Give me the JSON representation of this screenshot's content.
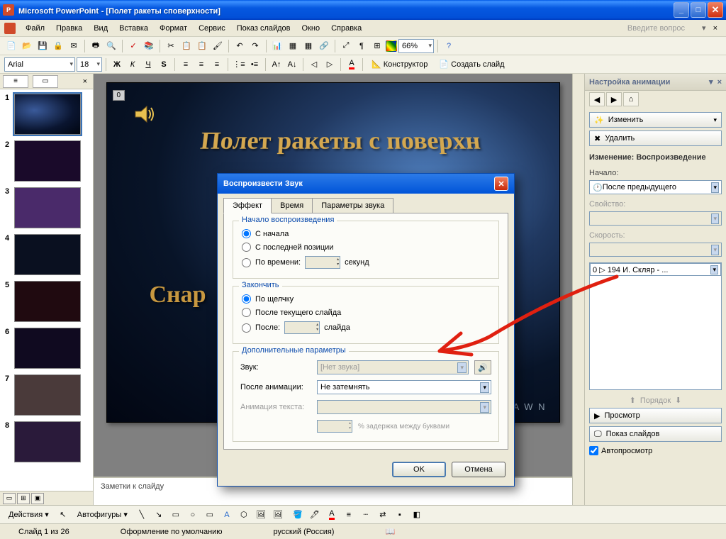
{
  "titlebar": {
    "app": "Microsoft PowerPoint",
    "doc": "[Полет ракеты споверхности]"
  },
  "menu": [
    "Файл",
    "Правка",
    "Вид",
    "Вставка",
    "Формат",
    "Сервис",
    "Показ слайдов",
    "Окно",
    "Справка"
  ],
  "ask_prompt": "Введите вопрос",
  "toolbar2": {
    "zoom": "66%",
    "designer": "Конструктор",
    "new_slide": "Создать слайд"
  },
  "formatbar": {
    "font_name": "Arial",
    "font_size": "18"
  },
  "slide": {
    "label_zero": "0",
    "title": "Полет ракеты с поверхн",
    "subtitle": "Снар",
    "watermark": "A W N"
  },
  "notes_placeholder": "Заметки к слайду",
  "taskpane": {
    "title": "Настройка анимации",
    "change_btn": "Изменить",
    "delete_btn": "Удалить",
    "heading": "Изменение: Воспроизведение",
    "start_label": "Начало:",
    "start_value": "После предыдущего",
    "prop_label": "Свойство:",
    "speed_label": "Скорость:",
    "list_item": "0     ▷   194 И. Скляр - ...",
    "order": "Порядок",
    "preview": "Просмотр",
    "slideshow": "Показ слайдов",
    "autoplay": "Автопросмотр"
  },
  "dialog": {
    "title": "Воспроизвести Звук",
    "tabs": [
      "Эффект",
      "Время",
      "Параметры звука"
    ],
    "start_group": "Начало воспроизведения",
    "r_from_start": "С начала",
    "r_from_last": "С последней позиции",
    "r_by_time": "По времени:",
    "seconds": "секунд",
    "end_group": "Закончить",
    "r_on_click": "По щелчку",
    "r_after_current": "После текущего слайда",
    "r_after": "После:",
    "slides": "слайда",
    "extra_group": "Дополнительные параметры",
    "sound_label": "Звук:",
    "sound_value": "[Нет звука]",
    "after_anim_label": "После анимации:",
    "after_anim_value": "Не затемнять",
    "anim_text_label": "Анимация текста:",
    "delay_hint": "% задержка между буквами",
    "ok": "OK",
    "cancel": "Отмена"
  },
  "drawbar": {
    "actions": "Действия",
    "autoshapes": "Автофигуры"
  },
  "status": {
    "slide": "Слайд 1 из 26",
    "design": "Оформление по умолчанию",
    "lang": "русский (Россия)"
  }
}
